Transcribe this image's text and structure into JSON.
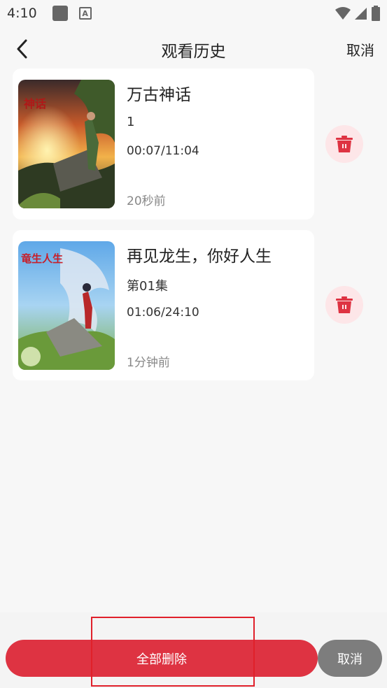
{
  "status_bar": {
    "time": "4:10",
    "a_label": "A"
  },
  "header": {
    "title": "观看历史",
    "cancel_label": "取消"
  },
  "history": [
    {
      "title": "万古神话",
      "episode": "1",
      "progress": "00:07/11:04",
      "time_ago": "20秒前",
      "cover_text": "神话"
    },
    {
      "title": "再见龙生，你好人生",
      "episode": "第01集",
      "progress": "01:06/24:10",
      "time_ago": "1分钟前",
      "cover_text": "竜生人生"
    }
  ],
  "bottom": {
    "delete_all_label": "全部删除",
    "cancel_label": "取消"
  },
  "colors": {
    "accent_red": "#de3342",
    "delete_bg": "#fde6e8",
    "cancel_gray": "#7d7d7d"
  }
}
